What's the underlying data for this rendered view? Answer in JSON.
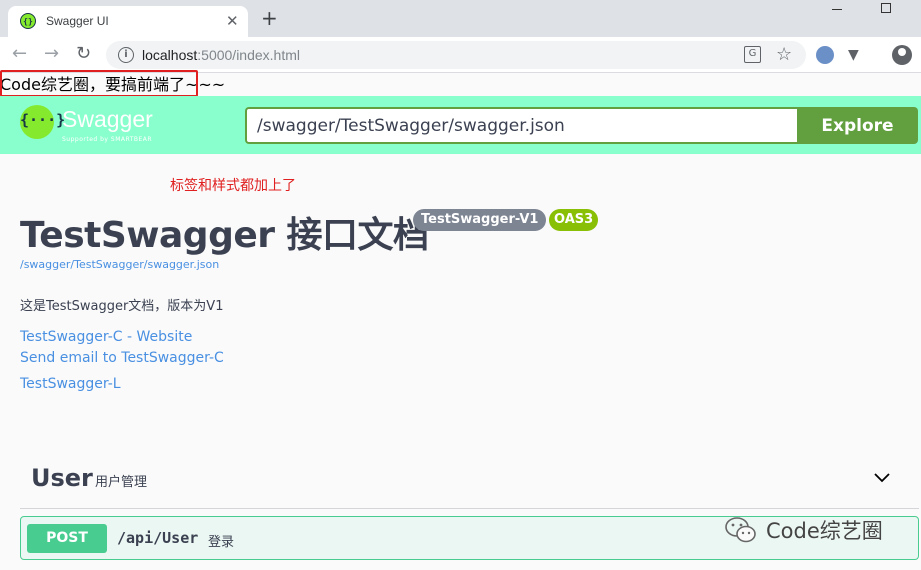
{
  "browser": {
    "tab_title": "Swagger UI",
    "close_glyph": "✕",
    "new_tab_glyph": "+",
    "url_host": "localhost",
    "url_path": ":5000/index.html"
  },
  "custom_text": "Code综艺圈，要搞前端了~~~",
  "topbar": {
    "brand": "Swagger",
    "brand_sub": "Supported by SMARTBEAR",
    "spec_url": "/swagger/TestSwagger/swagger.json",
    "explore_label": "Explore"
  },
  "info": {
    "annotation": "标签和样式都加上了",
    "title": "TestSwagger 接口文档",
    "version_badge": "TestSwagger-V1",
    "oas_badge": "OAS3",
    "spec_link": "/swagger/TestSwagger/swagger.json",
    "description": "这是TestSwagger文档，版本为V1",
    "website_link": "TestSwagger-C - Website",
    "email_link": "Send email to TestSwagger-C",
    "license_link": "TestSwagger-L"
  },
  "tag": {
    "name": "User",
    "description": "用户管理"
  },
  "operation": {
    "method": "POST",
    "path": "/api/User",
    "summary": "登录"
  },
  "watermark": {
    "text": "Code综艺圈"
  },
  "colors": {
    "topbar_bg": "#89ffcd",
    "explore_green": "#62a03f",
    "post_green": "#49cc90",
    "link_blue": "#4990e2",
    "annotation_red": "#e02020"
  }
}
